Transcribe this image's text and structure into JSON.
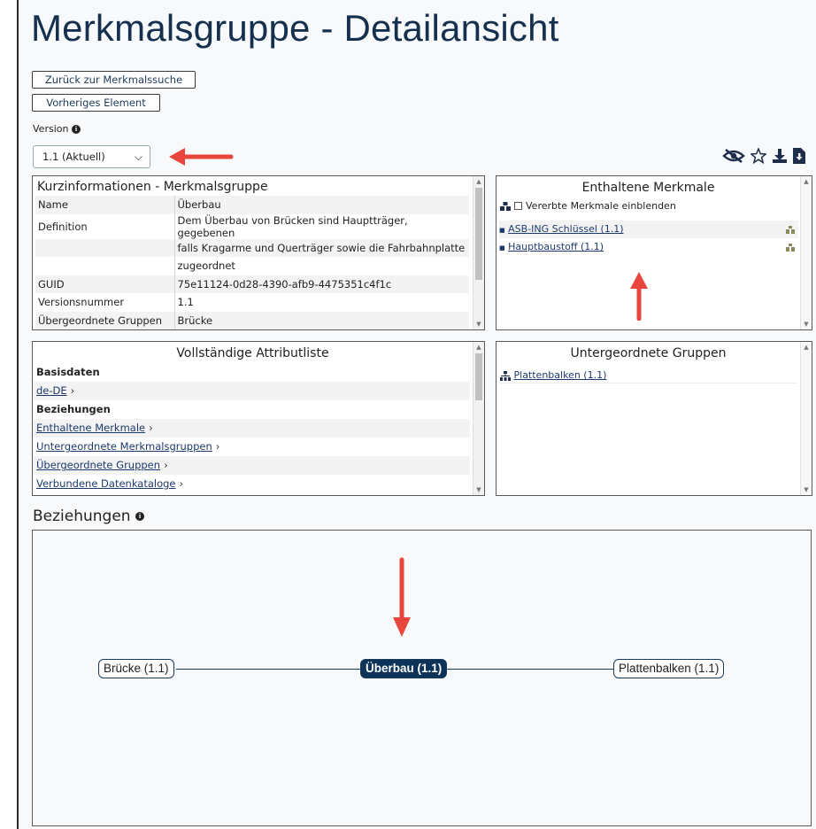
{
  "page": {
    "title": "Merkmalsgruppe - Detailansicht",
    "back_button": "Zurück zur Merkmalssuche",
    "prev_button": "Vorheriges Element",
    "version_label": "Version",
    "version_selected": "1.1 (Aktuell)"
  },
  "toolbar": {
    "icons": [
      "eye-slash-icon",
      "star-icon",
      "download-icon",
      "file-download-icon"
    ]
  },
  "kurzinfo": {
    "title": "Kurzinformationen - Merkmalsgruppe",
    "rows": [
      {
        "key": "Name",
        "value": "Überbau"
      },
      {
        "key": "Definition",
        "value": "Dem Überbau von Brücken sind Hauptträger, gegebenen"
      },
      {
        "key": "",
        "value": "falls Kragarme und Querträger sowie die Fahrbahnplatte"
      },
      {
        "key": "",
        "value": "zugeordnet"
      },
      {
        "key": "GUID",
        "value": "75e11124-0d28-4390-afb9-4475351c4f1c"
      },
      {
        "key": "Versionsnummer",
        "value": "1.1"
      },
      {
        "key": "Übergeordnete Gruppen",
        "value": "Brücke"
      }
    ]
  },
  "merkmale": {
    "title": "Enthaltene Merkmale",
    "checkbox_label": "Vererbte Merkmale einblenden",
    "items": [
      "ASB-ING Schlüssel (1.1)",
      "Hauptbaustoff (1.1)"
    ]
  },
  "attribute": {
    "title": "Vollständige Attributliste",
    "rows": [
      {
        "text": "Basisdaten",
        "kind": "header"
      },
      {
        "text": "de-DE",
        "kind": "link"
      },
      {
        "text": "Beziehungen",
        "kind": "header"
      },
      {
        "text": "Enthaltene Merkmale",
        "kind": "link"
      },
      {
        "text": "Untergeordnete Merkmalsgruppen",
        "kind": "link"
      },
      {
        "text": "Übergeordnete Gruppen",
        "kind": "link"
      },
      {
        "text": "Verbundene Datenkataloge",
        "kind": "link"
      }
    ]
  },
  "untergruppen": {
    "title": "Untergeordnete Gruppen",
    "items": [
      "Plattenbalken (1.1)"
    ]
  },
  "beziehungen": {
    "title": "Beziehungen",
    "nodes": {
      "left": "Brücke (1.1)",
      "center": "Überbau (1.1)",
      "right": "Plattenbalken (1.1)"
    }
  },
  "colors": {
    "title": "#15304f",
    "accent": "#0d3358",
    "arrow": "#e8453c"
  }
}
